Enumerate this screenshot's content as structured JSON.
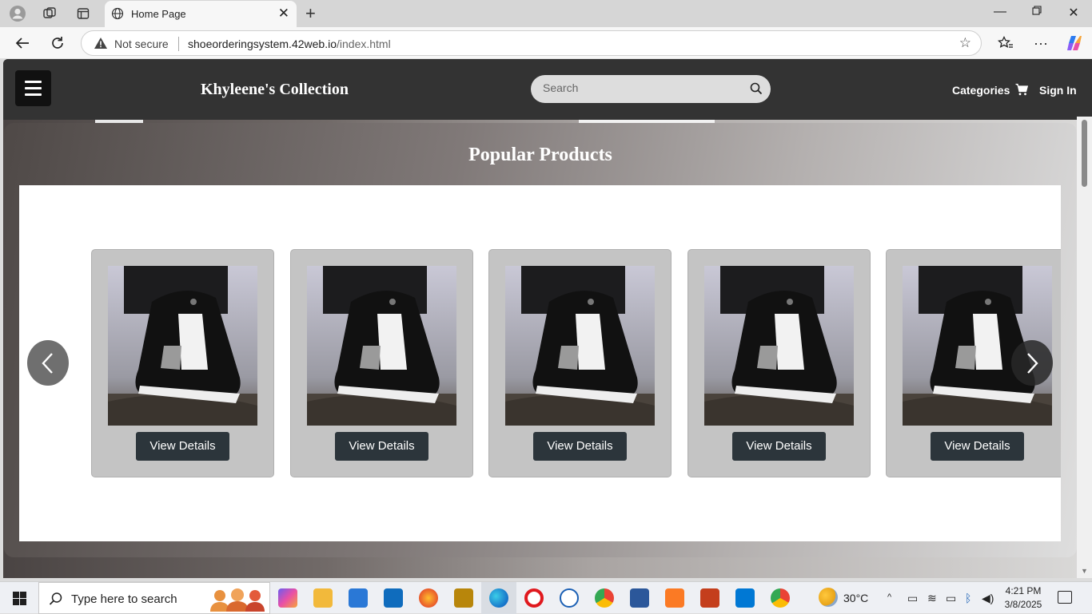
{
  "browser": {
    "tab_title": "Home Page",
    "security_label": "Not secure",
    "url_domain": "shoeorderingsystem.42web.io",
    "url_path": "/index.html"
  },
  "site": {
    "brand": "Khyleene's Collection",
    "search_placeholder": "Search",
    "nav": {
      "categories": "Categories",
      "sign_in": "Sign In"
    }
  },
  "popular": {
    "title": "Popular Products",
    "products": [
      {
        "button": "View Details",
        "image": "black-white-sneaker"
      },
      {
        "button": "View Details",
        "image": "black-white-sneaker"
      },
      {
        "button": "View Details",
        "image": "black-white-sneaker"
      },
      {
        "button": "View Details",
        "image": "black-white-sneaker"
      },
      {
        "button": "View Details",
        "image": "black-white-sneaker"
      }
    ]
  },
  "taskbar": {
    "search_placeholder": "Type here to search",
    "weather": "30°C",
    "time": "4:21 PM",
    "date": "3/8/2025"
  },
  "colors": {
    "header_bg": "#333333",
    "button_bg": "#2c353b",
    "card_bg": "#c4c4c4"
  }
}
